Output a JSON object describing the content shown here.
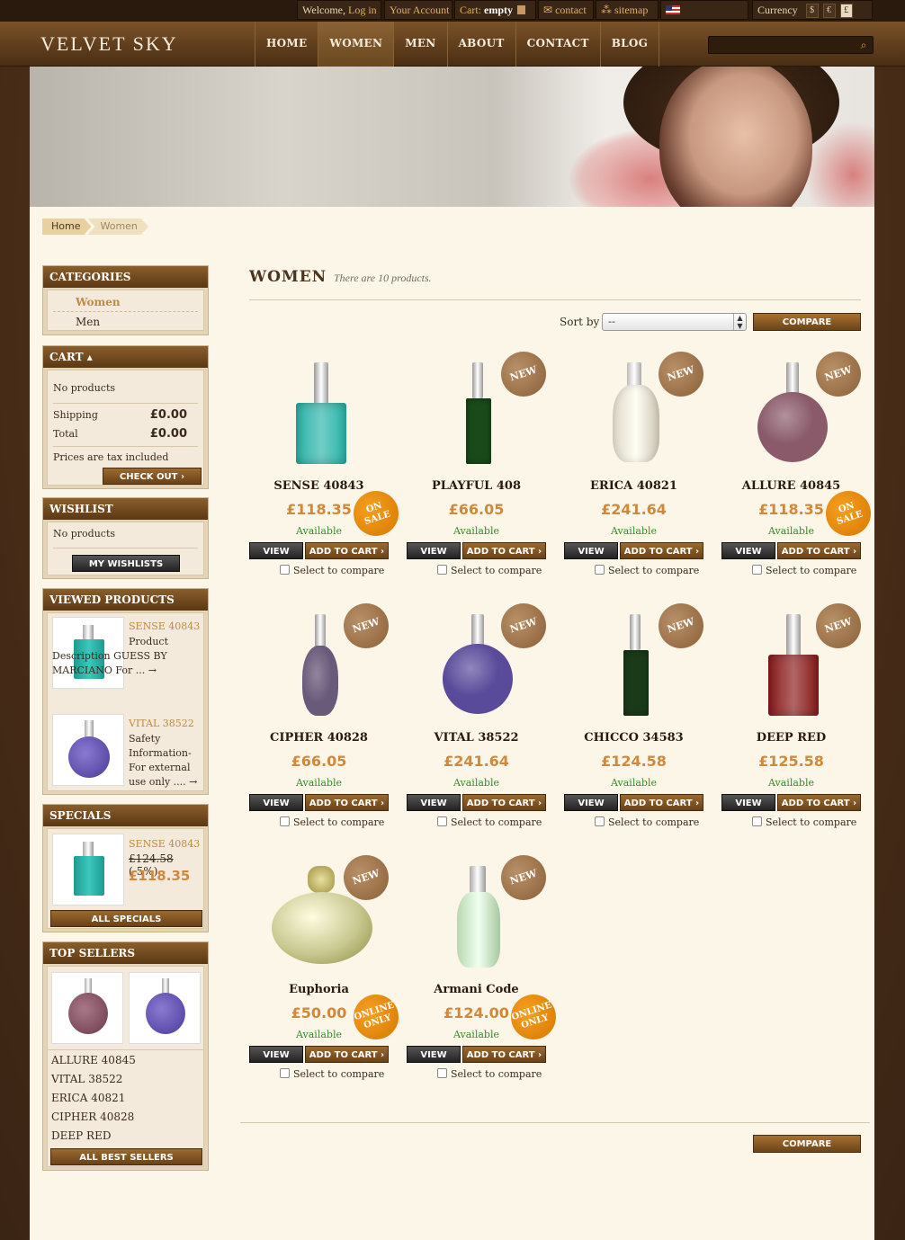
{
  "topbar": {
    "welcome": "Welcome,",
    "login": "Log in",
    "account": "Your Account",
    "cart_label": "Cart:",
    "cart_value": "empty",
    "contact": "contact",
    "sitemap": "sitemap",
    "currency_label": "Currency",
    "currencies": [
      "$",
      "€",
      "£"
    ]
  },
  "header": {
    "logo": "VELVET SKY",
    "nav": [
      "HOME",
      "WOMEN",
      "MEN",
      "ABOUT",
      "CONTACT",
      "BLOG"
    ],
    "search_placeholder": ""
  },
  "breadcrumb": [
    "Home",
    "Women"
  ],
  "sidebar": {
    "categories": {
      "title": "CATEGORIES",
      "items": [
        "Women",
        "Men"
      ]
    },
    "cart": {
      "title": "CART ▴",
      "empty": "No products",
      "shipping_label": "Shipping",
      "shipping_value": "£0.00",
      "total_label": "Total",
      "total_value": "£0.00",
      "tax_note": "Prices are tax included",
      "checkout": "CHECK OUT ›"
    },
    "wishlist": {
      "title": "WISHLIST",
      "empty": "No products",
      "button": "MY WISHLISTS"
    },
    "viewed": {
      "title": "VIEWED PRODUCTS",
      "items": [
        {
          "name": "SENSE 40843",
          "desc": "Product Description GUESS BY MARCIANO For ... →"
        },
        {
          "name": "VITAL 38522",
          "desc": "Safety Information- For external use only .... →"
        }
      ]
    },
    "specials": {
      "title": "SPECIALS",
      "name": "SENSE 40843",
      "old_price": "£124.58",
      "discount": "(-5%)",
      "price": "£118.35",
      "button": "ALL SPECIALS"
    },
    "topsellers": {
      "title": "TOP SELLERS",
      "items": [
        "ALLURE 40845",
        "VITAL 38522",
        "ERICA 40821",
        "CIPHER 40828",
        "DEEP RED"
      ],
      "button": "ALL BEST SELLERS"
    }
  },
  "main": {
    "title": "WOMEN",
    "count": "There are 10 products.",
    "sort_label": "Sort by",
    "sort_value": "--",
    "compare": "COMPARE",
    "view_label": "VIEW",
    "add_label": "ADD TO CART ›",
    "compare_check": "Select to compare",
    "products": [
      {
        "name": "SENSE 40843",
        "price": "£118.35",
        "avail": "Available",
        "badge": "ON SALE",
        "color": "#2ab4a8"
      },
      {
        "name": "PLAYFUL 408",
        "price": "£66.05",
        "avail": "Available",
        "badge": "NEW",
        "color": "#1a4a1a"
      },
      {
        "name": "ERICA 40821",
        "price": "£241.64",
        "avail": "Available",
        "badge": "NEW",
        "color": "#e8e4d8"
      },
      {
        "name": "ALLURE 40845",
        "price": "£118.35",
        "avail": "Available",
        "badge": "ON SALE",
        "badge2": "NEW",
        "color": "#8a5a6a"
      },
      {
        "name": "CIPHER 40828",
        "price": "£66.05",
        "avail": "Available",
        "badge": "NEW",
        "color": "#6a5a7a"
      },
      {
        "name": "VITAL 38522",
        "price": "£241.64",
        "avail": "Available",
        "badge": "NEW",
        "color": "#5a4a9a"
      },
      {
        "name": "CHICCO 34583",
        "price": "£124.58",
        "avail": "Available",
        "badge": "NEW",
        "color": "#1a3a1a"
      },
      {
        "name": "DEEP RED",
        "price": "£125.58",
        "avail": "Available",
        "badge": "NEW",
        "color": "#8a1a1a"
      },
      {
        "name": "Euphoria",
        "price": "£50.00",
        "avail": "Available",
        "badge": "ONLINE ONLY",
        "badge2": "NEW",
        "color": "#c8c890"
      },
      {
        "name": "Armani Code",
        "price": "£124.00",
        "avail": "Available",
        "badge": "ONLINE ONLY",
        "badge2": "NEW",
        "color": "#c8e0c0"
      }
    ]
  }
}
